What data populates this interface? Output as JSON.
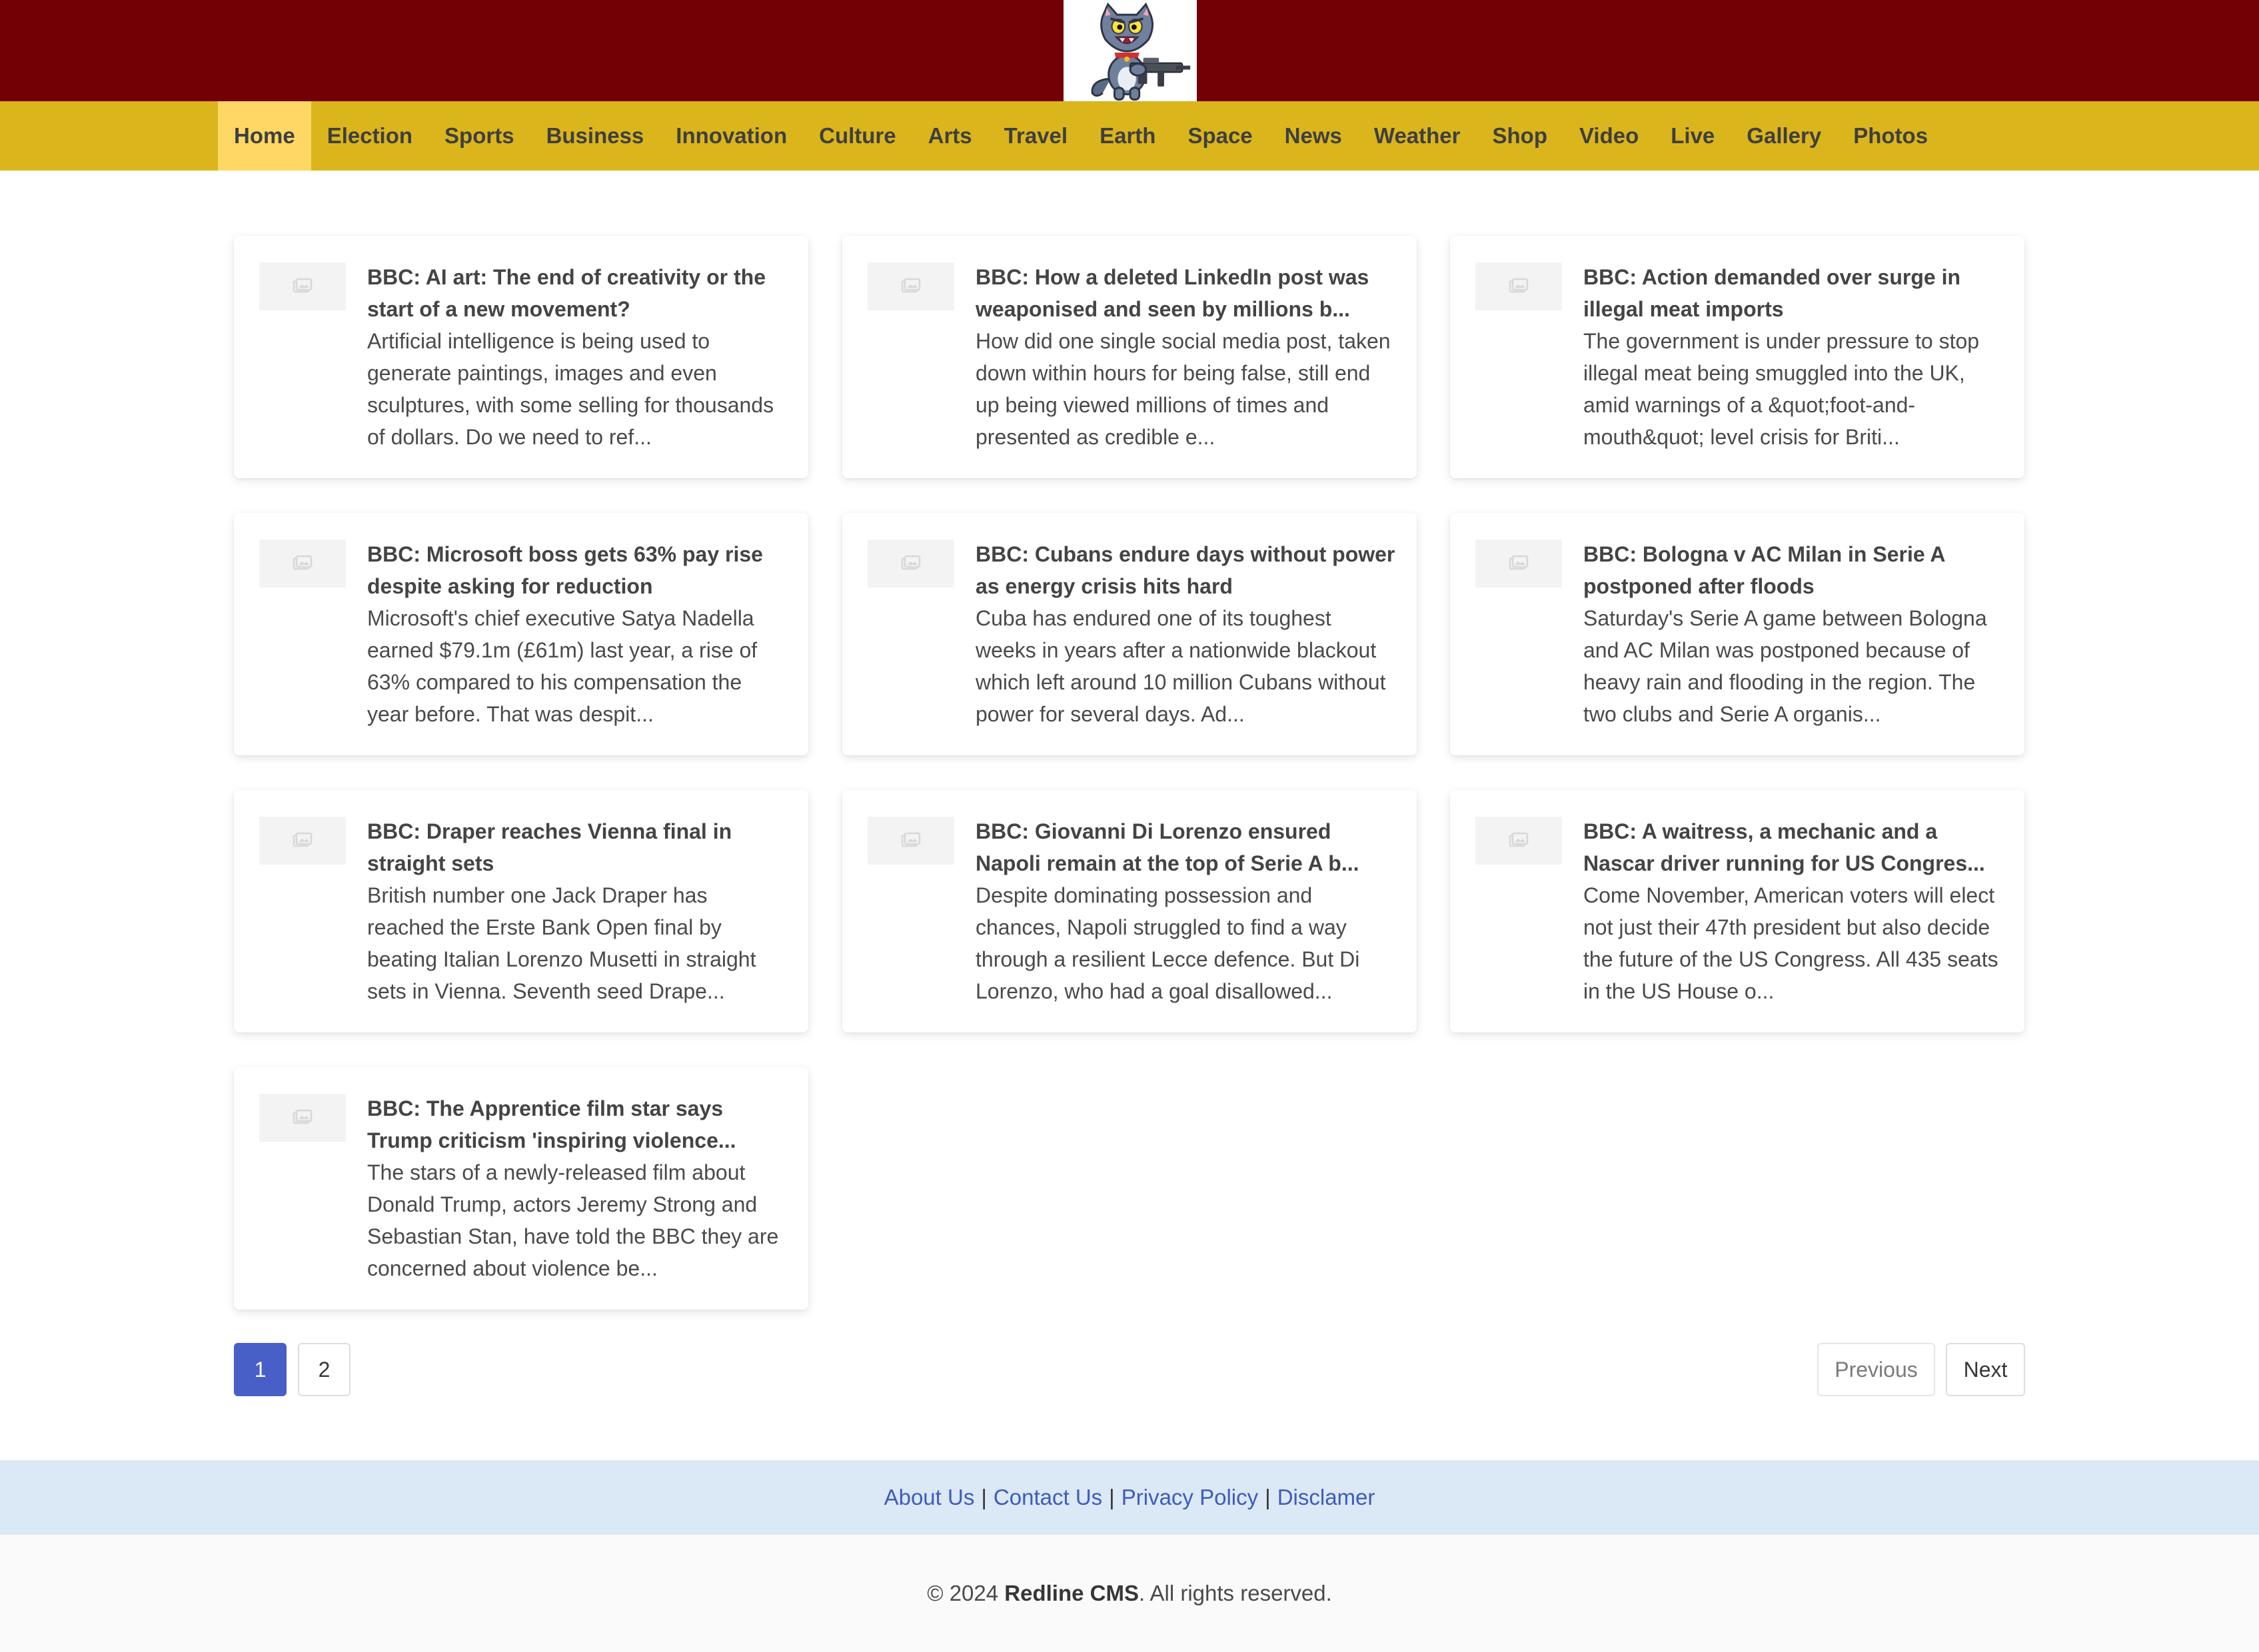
{
  "header": {
    "logo_alt": "cat mascot logo"
  },
  "nav": {
    "items": [
      "Home",
      "Election",
      "Sports",
      "Business",
      "Innovation",
      "Culture",
      "Arts",
      "Travel",
      "Earth",
      "Space",
      "News",
      "Weather",
      "Shop",
      "Video",
      "Live",
      "Gallery",
      "Photos"
    ],
    "active": "Home"
  },
  "articles": [
    {
      "title": "BBC: AI art: The end of creativity or the start of a new movement?",
      "summary": "Artificial intelligence is being used to generate paintings, images and even sculptures, with some selling for thousands of dollars. Do we need to ref..."
    },
    {
      "title": "BBC: How a deleted LinkedIn post was weaponised and seen by millions b...",
      "summary": "How did one single social media post, taken down within hours for being false, still end up being viewed millions of times and presented as credible e..."
    },
    {
      "title": "BBC: Action demanded over surge in illegal meat imports",
      "summary": "The government is under pressure to stop illegal meat being smuggled into the UK, amid warnings of a &quot;foot-and-mouth&quot; level crisis for Briti..."
    },
    {
      "title": "BBC: Microsoft boss gets 63% pay rise despite asking for reduction",
      "summary": "Microsoft's chief executive Satya Nadella earned $79.1m (£61m) last year, a rise of 63% compared to his compensation the year before. That was despit..."
    },
    {
      "title": "BBC: Cubans endure days without power as energy crisis hits hard",
      "summary": "Cuba has endured one of its toughest weeks in years after a nationwide blackout which left around 10 million Cubans without power for several days. Ad..."
    },
    {
      "title": "BBC: Bologna v AC Milan in Serie A postponed after floods",
      "summary": "Saturday's Serie A game between Bologna and AC Milan was postponed because of heavy rain and flooding in the region. The two clubs and Serie A organis..."
    },
    {
      "title": "BBC: Draper reaches Vienna final in straight sets",
      "summary": "British number one Jack Draper has reached the Erste Bank Open final by beating Italian Lorenzo Musetti in straight sets in Vienna. Seventh seed Drape..."
    },
    {
      "title": "BBC: Giovanni Di Lorenzo ensured Napoli remain at the top of Serie A b...",
      "summary": "Despite dominating possession and chances, Napoli struggled to find a way through a resilient Lecce defence. But Di Lorenzo, who had a goal disallowed..."
    },
    {
      "title": "BBC: A waitress, a mechanic and a Nascar driver running for US Congres...",
      "summary": "Come November, American voters will elect not just their 47th president but also decide the future of the US Congress. All 435 seats in the US House o..."
    },
    {
      "title": "BBC: The Apprentice film star says Trump criticism 'inspiring violence...",
      "summary": "The stars of a newly-released film about Donald Trump, actors Jeremy Strong and Sebastian Stan, have told the BBC they are concerned about violence be..."
    }
  ],
  "pagination": {
    "pages": [
      "1",
      "2"
    ],
    "current": "1",
    "previous_label": "Previous",
    "next_label": "Next"
  },
  "footer": {
    "links": [
      "About Us",
      "Contact Us",
      "Privacy Policy",
      "Disclamer"
    ],
    "separator": "|",
    "copyright_prefix": "© 2024 ",
    "brand": "Redline CMS",
    "copyright_suffix": ". All rights reserved."
  },
  "colors": {
    "header_bg": "#720004",
    "nav_bg": "#dbb51c",
    "nav_active_bg": "#fed764",
    "pagination_current": "#485fc7",
    "footer_links_bg": "#dbe8f5",
    "link_color": "#3e5cb8"
  }
}
